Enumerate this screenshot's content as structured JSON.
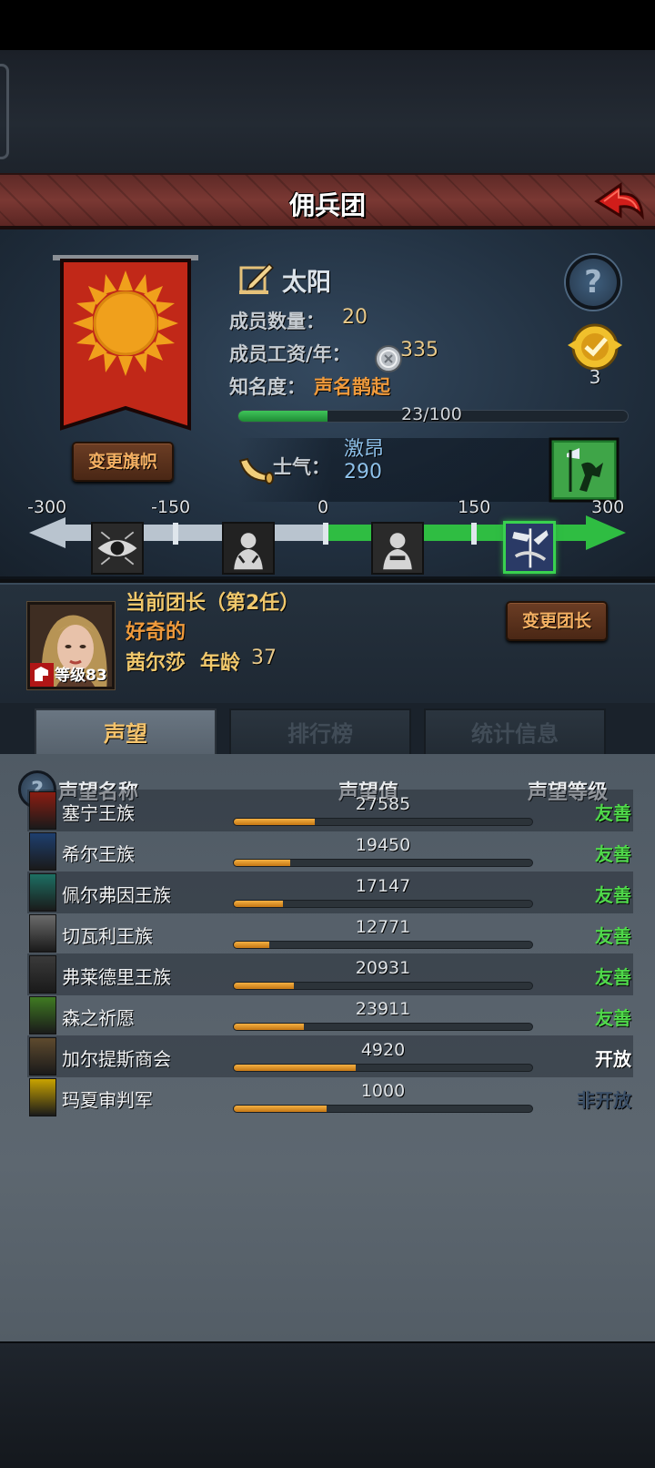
{
  "header": {
    "title": "佣兵团"
  },
  "merc": {
    "name": "太阳",
    "change_banner_label": "变更旗帜",
    "members_label": "成员数量：",
    "members_value": "20",
    "wage_label": "成员工资/年：",
    "wage_value": "335",
    "fame_label": "知名度：",
    "fame_value": "声名鹊起",
    "fame_progress_text": "23/100",
    "fame_progress": 0.23,
    "medal_count": "3",
    "morale_label": "士气：",
    "morale_state": "激昂",
    "morale_value": "290"
  },
  "morale_scale": {
    "ticks": [
      "-300",
      "-150",
      "0",
      "150",
      "300"
    ],
    "current": 290
  },
  "leader": {
    "title": "当前团长（第2任）",
    "trait": "好奇的",
    "name": "茜尔莎",
    "age_label": "年龄",
    "age": "37",
    "level_label": "等级83",
    "change_leader_label": "变更团长"
  },
  "tabs": [
    {
      "label": "声望",
      "active": true
    },
    {
      "label": "排行榜",
      "active": false
    },
    {
      "label": "统计信息",
      "active": false
    }
  ],
  "reputation": {
    "columns": {
      "name": "声望名称",
      "value": "声望值",
      "level": "声望等级"
    },
    "rows": [
      {
        "name": "塞宁王族",
        "value": "27585",
        "fill": 0.27,
        "level": "友善",
        "level_color": "#4fd84a",
        "icon_color": "#8a1d12"
      },
      {
        "name": "希尔王族",
        "value": "19450",
        "fill": 0.19,
        "level": "友善",
        "level_color": "#4fd84a",
        "icon_color": "#1e3f6e"
      },
      {
        "name": "佩尔弗因王族",
        "value": "17147",
        "fill": 0.165,
        "level": "友善",
        "level_color": "#4fd84a",
        "icon_color": "#1d6f63"
      },
      {
        "name": "切瓦利王族",
        "value": "12771",
        "fill": 0.12,
        "level": "友善",
        "level_color": "#4fd84a",
        "icon_color": "#6b6b6b"
      },
      {
        "name": "弗莱德里王族",
        "value": "20931",
        "fill": 0.2,
        "level": "友善",
        "level_color": "#4fd84a",
        "icon_color": "#3a3a3a"
      },
      {
        "name": "森之祈愿",
        "value": "23911",
        "fill": 0.235,
        "level": "友善",
        "level_color": "#4fd84a",
        "icon_color": "#3f7a22"
      },
      {
        "name": "加尔提斯商会",
        "value": "4920",
        "fill": 0.41,
        "level": "开放",
        "level_color": "#ffffff",
        "icon_color": "#5e4a2e"
      },
      {
        "name": "玛夏审判军",
        "value": "1000",
        "fill": 0.31,
        "level": "非开放",
        "level_color": "#3a4e66",
        "icon_color": "#c9a300"
      }
    ]
  },
  "colors": {
    "banner_red": "#c12818",
    "sun_orange": "#f0a01c",
    "morale_green": "#2fbd42",
    "accent_orange": "#ef9a3c"
  }
}
